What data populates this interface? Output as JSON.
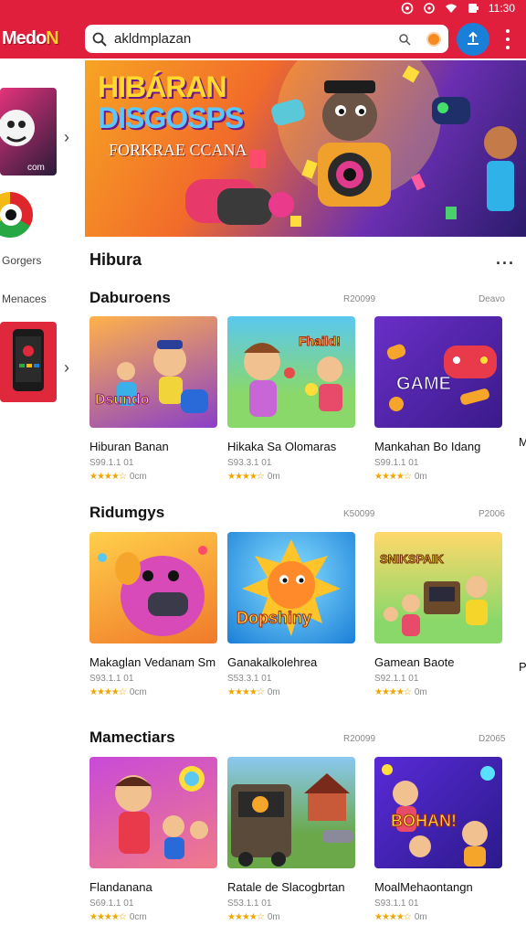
{
  "app": {
    "logo_main": "Medo",
    "logo_accent": "N"
  },
  "status_bar": {
    "time": "11:30"
  },
  "search": {
    "value": "akldmplazan"
  },
  "hero": {
    "title_line1": "HIBÁRAN",
    "title_line2": "DISGOSPS",
    "subtitle": "FORKRAE CCANA"
  },
  "rail": {
    "label_1": "Gorgers",
    "label_2": "Menaces",
    "tile_text": "com"
  },
  "section_main": {
    "title": "Hibura",
    "more": "···"
  },
  "sections": [
    {
      "title": "Daburoens",
      "meta_left": "R20099",
      "meta_right": "Deavo",
      "cards": [
        {
          "name": "Hiburan Banan",
          "meta": "S99.1.1 01",
          "reviews": "0cm",
          "img_text": "Dsundo"
        },
        {
          "name": "Hikaka Sa Olomaras",
          "meta": "S93.3.1 01",
          "reviews": "0m",
          "img_text": "Fhaild!"
        },
        {
          "name": "Mankahan Bo Idang",
          "meta": "S99.1.1 01",
          "reviews": "0m",
          "img_text": "GAME"
        }
      ],
      "peek": "M"
    },
    {
      "title": "Ridumgys",
      "meta_left": "K50099",
      "meta_right": "P2006",
      "cards": [
        {
          "name": "Makaglan Vedanam Sm",
          "meta": "S93.1.1 01",
          "reviews": "0cm",
          "img_text": ""
        },
        {
          "name": "Ganakalkolehrea",
          "meta": "S53.3.1 01",
          "reviews": "0m",
          "img_text": "Dopshiny"
        },
        {
          "name": "Gamean Baote",
          "meta": "S92.1.1 01",
          "reviews": "0m",
          "img_text": "SNIKSPAIK"
        }
      ],
      "peek": "P"
    },
    {
      "title": "Mamectiars",
      "meta_left": "R20099",
      "meta_right": "D2065",
      "cards": [
        {
          "name": "Flandanana",
          "meta": "S69.1.1 01",
          "reviews": "0cm",
          "img_text": ""
        },
        {
          "name": "Ratale de Slacogbrtan",
          "meta": "S53.1.1 01",
          "reviews": "0m",
          "img_text": ""
        },
        {
          "name": "MoalMehaontangn",
          "meta": "S93.1.1 01",
          "reviews": "0m",
          "img_text": "BOHAN!"
        }
      ],
      "peek": ""
    }
  ],
  "stars": "★★★★☆",
  "colors": {
    "brand": "#e01f3d",
    "action": "#1a7fd8",
    "star": "#f0a500"
  }
}
